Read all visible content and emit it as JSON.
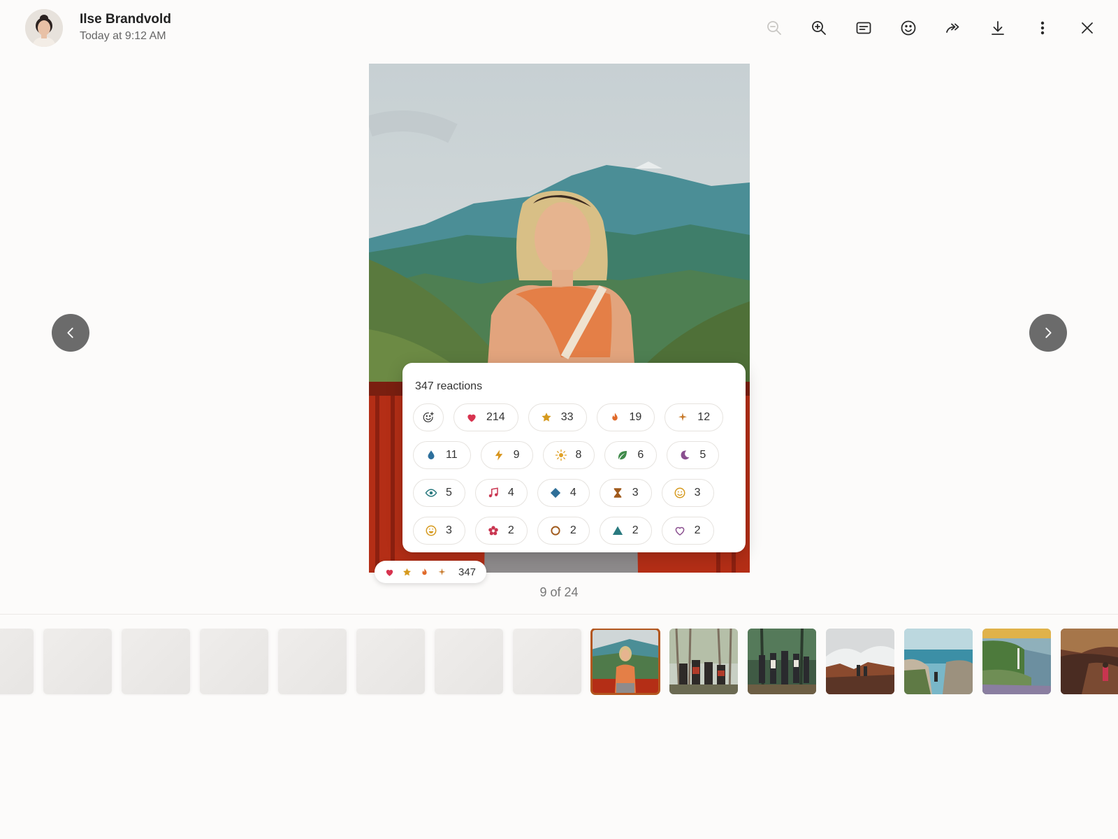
{
  "header": {
    "author_name": "Ilse Brandvold",
    "timestamp": "Today at 9:12 AM"
  },
  "toolbar": {
    "buttons": [
      {
        "icon": "zoom-out-icon",
        "enabled": false
      },
      {
        "icon": "zoom-in-icon",
        "enabled": true
      },
      {
        "icon": "caption-icon",
        "enabled": true
      },
      {
        "icon": "emoji-icon",
        "enabled": true
      },
      {
        "icon": "forward-icon",
        "enabled": true
      },
      {
        "icon": "download-icon",
        "enabled": true
      },
      {
        "icon": "more-icon",
        "enabled": true
      },
      {
        "icon": "close-icon",
        "enabled": true
      }
    ]
  },
  "reactions": {
    "title": "347 reactions",
    "items": [
      {
        "icon": "heart",
        "count": "214",
        "color": "#d7334f"
      },
      {
        "icon": "star",
        "count": "33",
        "color": "#d69a1f"
      },
      {
        "icon": "flame",
        "count": "19",
        "color": "#e06a2a"
      },
      {
        "icon": "sparkle",
        "count": "12",
        "color": "#c7792a"
      },
      {
        "icon": "drop",
        "count": "11",
        "color": "#2d6f9c"
      },
      {
        "icon": "bolt",
        "count": "9",
        "color": "#d7941c"
      },
      {
        "icon": "sun",
        "count": "8",
        "color": "#e0a126"
      },
      {
        "icon": "leaf",
        "count": "6",
        "color": "#3f8a4a"
      },
      {
        "icon": "moon",
        "count": "5",
        "color": "#8a4f8f"
      },
      {
        "icon": "eye",
        "count": "5",
        "color": "#2a7a7f"
      },
      {
        "icon": "note",
        "count": "4",
        "color": "#c93550"
      },
      {
        "icon": "diamond",
        "count": "4",
        "color": "#2f6f98"
      },
      {
        "icon": "hourglass",
        "count": "3",
        "color": "#a05a1c"
      },
      {
        "icon": "smile",
        "count": "3",
        "color": "#d69a1f"
      },
      {
        "icon": "grin",
        "count": "3",
        "color": "#d69a1f"
      },
      {
        "icon": "flower",
        "count": "2",
        "color": "#c93550"
      },
      {
        "icon": "ring",
        "count": "2",
        "color": "#a05a1c"
      },
      {
        "icon": "triangle",
        "count": "2",
        "color": "#2a7a7f"
      },
      {
        "icon": "heart-outline",
        "count": "2",
        "color": "#8a4f8f"
      }
    ]
  },
  "summary": {
    "icons": [
      "heart",
      "star",
      "flame",
      "sparkle"
    ],
    "count": "347"
  },
  "counter": "9 of 24",
  "filmstrip": {
    "active_index": 8,
    "thumbnails": [
      "placeholder",
      "placeholder",
      "placeholder",
      "placeholder",
      "placeholder",
      "placeholder",
      "placeholder",
      "placeholder",
      "woman-mountains",
      "group-forest",
      "group-trail",
      "misty-cliffs",
      "coast-cliff",
      "green-coast",
      "hiker-canyon"
    ]
  },
  "colors": {
    "accent": "#b3571f",
    "nav_button": "#6b6b6b"
  }
}
